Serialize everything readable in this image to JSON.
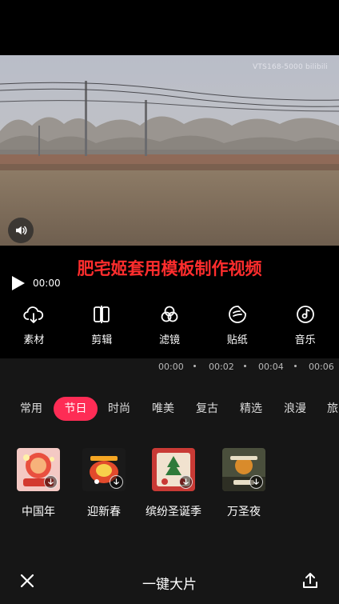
{
  "video": {
    "watermark": "VTS168-5000 bilibili"
  },
  "overlay": {
    "caption": "肥宅姬套用模板制作视频"
  },
  "player": {
    "time": "00:00"
  },
  "tools": [
    {
      "label": "素材",
      "icon": "cloud-download-icon"
    },
    {
      "label": "剪辑",
      "icon": "split-clip-icon"
    },
    {
      "label": "滤镜",
      "icon": "filter-circles-icon"
    },
    {
      "label": "贴纸",
      "icon": "sticker-icon"
    },
    {
      "label": "音乐",
      "icon": "music-disc-icon"
    }
  ],
  "timeline": {
    "ticks": [
      "00:00",
      "00:02",
      "00:04",
      "00:06"
    ]
  },
  "tabs": [
    {
      "label": "常用"
    },
    {
      "label": "节日",
      "active": true
    },
    {
      "label": "时尚"
    },
    {
      "label": "唯美"
    },
    {
      "label": "复古"
    },
    {
      "label": "精选"
    },
    {
      "label": "浪漫"
    },
    {
      "label": "旅"
    }
  ],
  "templates": [
    {
      "name": "中国年"
    },
    {
      "name": "迎新春"
    },
    {
      "name": "缤纷圣诞季"
    },
    {
      "name": "万圣夜"
    }
  ],
  "bottom": {
    "title": "一键大片"
  },
  "colors": {
    "accent": "#fe2c55",
    "caption": "#ff2d2d"
  }
}
